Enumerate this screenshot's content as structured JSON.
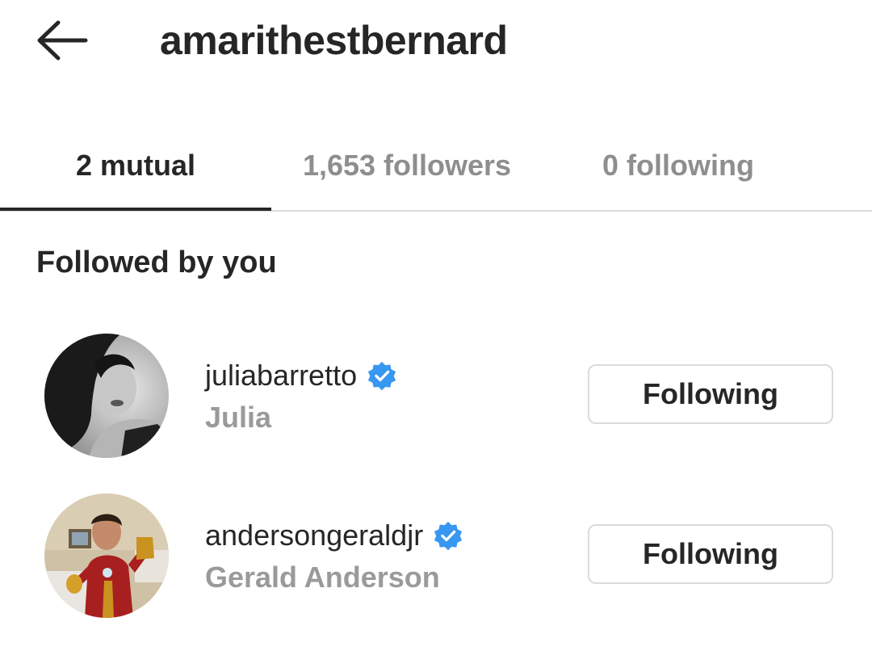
{
  "header": {
    "title": "amarithestbernard"
  },
  "tabs": [
    {
      "label": "2 mutual"
    },
    {
      "label": "1,653 followers"
    },
    {
      "label": "0 following"
    }
  ],
  "section": {
    "title": "Followed by you"
  },
  "users": [
    {
      "username": "juliabarretto",
      "full_name": "Julia",
      "button": "Following"
    },
    {
      "username": "andersongeraldjr",
      "full_name": "Gerald Anderson",
      "button": "Following"
    }
  ],
  "colors": {
    "text_primary": "#262626",
    "text_secondary": "#8e8e8e",
    "divider": "#dbdbdb",
    "verified": "#3897f0"
  }
}
